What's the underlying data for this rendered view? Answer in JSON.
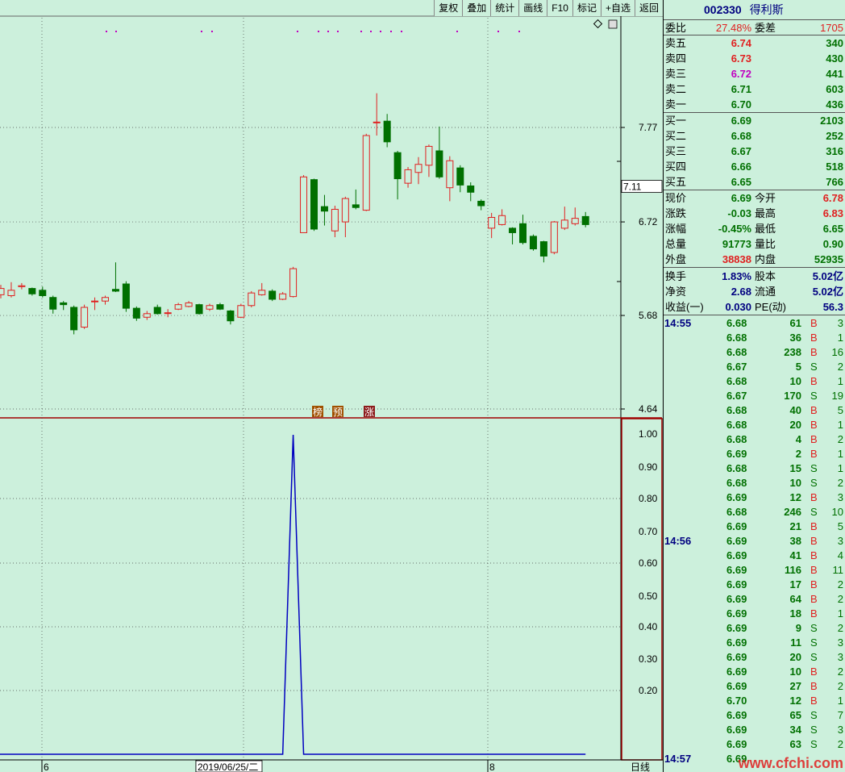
{
  "toolbar": {
    "items": [
      "复权",
      "叠加",
      "统计",
      "画线",
      "F10",
      "标记",
      "+自选",
      "返回"
    ]
  },
  "price_axis": {
    "labels": [
      "7.77",
      "7.11",
      "6.72",
      "5.68",
      "4.64"
    ]
  },
  "indicator_axis": {
    "labels": [
      "1.00",
      "0.90",
      "0.80",
      "0.70",
      "0.60",
      "0.50",
      "0.40",
      "0.30",
      "0.20"
    ]
  },
  "date_axis": {
    "labels": [
      "6",
      "2019/06/25/二",
      "8"
    ],
    "period": "日线"
  },
  "event_markers": [
    "榜",
    "预",
    "涨"
  ],
  "chart_data": [
    {
      "type": "candlestick",
      "title": "",
      "ylim": [
        4.64,
        8.2
      ],
      "current_price_tag": 7.11,
      "candles": [
        {
          "o": 5.91,
          "c": 5.98,
          "h": 6.02,
          "l": 5.87
        },
        {
          "o": 5.9,
          "c": 5.96,
          "h": 6.05,
          "l": 5.88
        },
        {
          "o": 6.0,
          "c": 6.01,
          "h": 6.04,
          "l": 5.97
        },
        {
          "o": 5.98,
          "c": 5.92,
          "h": 5.99,
          "l": 5.9
        },
        {
          "o": 5.96,
          "c": 5.9,
          "h": 6.0,
          "l": 5.88
        },
        {
          "o": 5.88,
          "c": 5.75,
          "h": 5.9,
          "l": 5.7
        },
        {
          "o": 5.82,
          "c": 5.8,
          "h": 5.84,
          "l": 5.74
        },
        {
          "o": 5.77,
          "c": 5.52,
          "h": 5.79,
          "l": 5.47
        },
        {
          "o": 5.55,
          "c": 5.77,
          "h": 5.8,
          "l": 5.53
        },
        {
          "o": 5.84,
          "c": 5.84,
          "h": 5.88,
          "l": 5.74
        },
        {
          "o": 5.84,
          "c": 5.88,
          "h": 5.9,
          "l": 5.8
        },
        {
          "o": 5.97,
          "c": 5.95,
          "h": 6.27,
          "l": 5.94
        },
        {
          "o": 6.03,
          "c": 5.76,
          "h": 6.06,
          "l": 5.72
        },
        {
          "o": 5.76,
          "c": 5.65,
          "h": 5.78,
          "l": 5.62
        },
        {
          "o": 5.66,
          "c": 5.7,
          "h": 5.73,
          "l": 5.63
        },
        {
          "o": 5.77,
          "c": 5.7,
          "h": 5.8,
          "l": 5.69
        },
        {
          "o": 5.71,
          "c": 5.71,
          "h": 5.75,
          "l": 5.66
        },
        {
          "o": 5.75,
          "c": 5.8,
          "h": 5.82,
          "l": 5.74
        },
        {
          "o": 5.78,
          "c": 5.82,
          "h": 5.84,
          "l": 5.77
        },
        {
          "o": 5.8,
          "c": 5.7,
          "h": 5.81,
          "l": 5.69
        },
        {
          "o": 5.75,
          "c": 5.79,
          "h": 5.81,
          "l": 5.73
        },
        {
          "o": 5.8,
          "c": 5.75,
          "h": 5.82,
          "l": 5.74
        },
        {
          "o": 5.73,
          "c": 5.62,
          "h": 5.74,
          "l": 5.58
        },
        {
          "o": 5.66,
          "c": 5.79,
          "h": 5.81,
          "l": 5.65
        },
        {
          "o": 5.79,
          "c": 5.93,
          "h": 5.95,
          "l": 5.77
        },
        {
          "o": 5.91,
          "c": 5.96,
          "h": 6.04,
          "l": 5.9
        },
        {
          "o": 5.95,
          "c": 5.86,
          "h": 5.97,
          "l": 5.84
        },
        {
          "o": 5.86,
          "c": 5.92,
          "h": 5.94,
          "l": 5.85
        },
        {
          "o": 5.89,
          "c": 6.2,
          "h": 6.22,
          "l": 5.88
        },
        {
          "o": 6.6,
          "c": 7.22,
          "h": 7.24,
          "l": 6.6
        },
        {
          "o": 7.19,
          "c": 6.64,
          "h": 7.2,
          "l": 6.62
        },
        {
          "o": 6.89,
          "c": 6.84,
          "h": 7.02,
          "l": 6.68
        },
        {
          "o": 6.62,
          "c": 6.86,
          "h": 6.9,
          "l": 6.55
        },
        {
          "o": 6.72,
          "c": 6.98,
          "h": 7.0,
          "l": 6.55
        },
        {
          "o": 6.91,
          "c": 6.88,
          "h": 7.08,
          "l": 6.86
        },
        {
          "o": 6.85,
          "c": 7.68,
          "h": 7.7,
          "l": 6.84
        },
        {
          "o": 7.83,
          "c": 7.83,
          "h": 8.15,
          "l": 7.68
        },
        {
          "o": 7.84,
          "c": 7.61,
          "h": 7.92,
          "l": 7.55
        },
        {
          "o": 7.49,
          "c": 7.2,
          "h": 7.51,
          "l": 6.97
        },
        {
          "o": 7.15,
          "c": 7.3,
          "h": 7.33,
          "l": 7.1
        },
        {
          "o": 7.27,
          "c": 7.36,
          "h": 7.44,
          "l": 7.14
        },
        {
          "o": 7.35,
          "c": 7.56,
          "h": 7.58,
          "l": 7.22
        },
        {
          "o": 7.51,
          "c": 7.22,
          "h": 7.78,
          "l": 7.2
        },
        {
          "o": 7.1,
          "c": 7.4,
          "h": 7.45,
          "l": 6.95
        },
        {
          "o": 7.32,
          "c": 7.13,
          "h": 7.35,
          "l": 7.05
        },
        {
          "o": 7.12,
          "c": 7.05,
          "h": 7.16,
          "l": 6.95
        },
        {
          "o": 6.95,
          "c": 6.9,
          "h": 6.97,
          "l": 6.85
        },
        {
          "o": 6.65,
          "c": 6.77,
          "h": 6.82,
          "l": 6.54
        },
        {
          "o": 6.69,
          "c": 6.79,
          "h": 6.86,
          "l": 6.68
        },
        {
          "o": 6.65,
          "c": 6.6,
          "h": 6.66,
          "l": 6.47
        },
        {
          "o": 6.7,
          "c": 6.49,
          "h": 6.8,
          "l": 6.47
        },
        {
          "o": 6.56,
          "c": 6.42,
          "h": 6.58,
          "l": 6.4
        },
        {
          "o": 6.5,
          "c": 6.34,
          "h": 6.51,
          "l": 6.27
        },
        {
          "o": 6.38,
          "c": 6.72,
          "h": 6.73,
          "l": 6.36
        },
        {
          "o": 6.65,
          "c": 6.74,
          "h": 6.89,
          "l": 6.63
        },
        {
          "o": 6.7,
          "c": 6.76,
          "h": 6.88,
          "l": 6.68
        },
        {
          "o": 6.78,
          "c": 6.69,
          "h": 6.83,
          "l": 6.66
        }
      ]
    },
    {
      "type": "line",
      "title": "",
      "ylim": [
        0,
        1.05
      ],
      "values": [
        0,
        0,
        0,
        0,
        0,
        0,
        0,
        0,
        0,
        0,
        0,
        0,
        0,
        0,
        0,
        0,
        0,
        0,
        0,
        0,
        0,
        0,
        0,
        0,
        0,
        0,
        0,
        0,
        1,
        0,
        0,
        0,
        0,
        0,
        0,
        0,
        0,
        0,
        0,
        0,
        0,
        0,
        0,
        0,
        0,
        0,
        0,
        0,
        0,
        0,
        0,
        0,
        0,
        0,
        0,
        0,
        0
      ]
    }
  ],
  "stock": {
    "code": "002330",
    "name": "得利斯"
  },
  "ratio": {
    "weibi_label": "委比",
    "weibi": "27.48%",
    "weicha_label": "委差",
    "weicha": "1705"
  },
  "asks": [
    {
      "label": "卖五",
      "price": "6.74",
      "vol": "340",
      "cls": "red"
    },
    {
      "label": "卖四",
      "price": "6.73",
      "vol": "430",
      "cls": "red"
    },
    {
      "label": "卖三",
      "price": "6.72",
      "vol": "441",
      "cls": "mag"
    },
    {
      "label": "卖二",
      "price": "6.71",
      "vol": "603",
      "cls": "green"
    },
    {
      "label": "卖一",
      "price": "6.70",
      "vol": "436",
      "cls": "green"
    }
  ],
  "bids": [
    {
      "label": "买一",
      "price": "6.69",
      "vol": "2103",
      "cls": "green"
    },
    {
      "label": "买二",
      "price": "6.68",
      "vol": "252",
      "cls": "green"
    },
    {
      "label": "买三",
      "price": "6.67",
      "vol": "316",
      "cls": "green"
    },
    {
      "label": "买四",
      "price": "6.66",
      "vol": "518",
      "cls": "green"
    },
    {
      "label": "买五",
      "price": "6.65",
      "vol": "766",
      "cls": "green"
    }
  ],
  "quote": [
    {
      "l1": "现价",
      "v1": "6.69",
      "c1": "green",
      "l2": "今开",
      "v2": "6.78",
      "c2": "red"
    },
    {
      "l1": "涨跌",
      "v1": "-0.03",
      "c1": "green",
      "l2": "最高",
      "v2": "6.83",
      "c2": "red"
    },
    {
      "l1": "涨幅",
      "v1": "-0.45%",
      "c1": "green",
      "l2": "最低",
      "v2": "6.65",
      "c2": "green"
    },
    {
      "l1": "总量",
      "v1": "91773",
      "c1": "green",
      "l2": "量比",
      "v2": "0.90",
      "c2": "green"
    },
    {
      "l1": "外盘",
      "v1": "38838",
      "c1": "red",
      "l2": "内盘",
      "v2": "52935",
      "c2": "green"
    }
  ],
  "fundamentals": [
    {
      "l1": "换手",
      "v1": "1.83%",
      "l2": "股本",
      "v2": "5.02亿"
    },
    {
      "l1": "净资",
      "v1": "2.68",
      "l2": "流通",
      "v2": "5.02亿"
    },
    {
      "l1": "收益(一)",
      "v1": "0.030",
      "l2": "PE(动)",
      "v2": "56.3"
    }
  ],
  "ticks": [
    {
      "time": "14:55",
      "price": "6.68",
      "vol": "61",
      "side": "B",
      "n": "3"
    },
    {
      "time": "",
      "price": "6.68",
      "vol": "36",
      "side": "B",
      "n": "1"
    },
    {
      "time": "",
      "price": "6.68",
      "vol": "238",
      "side": "B",
      "n": "16"
    },
    {
      "time": "",
      "price": "6.67",
      "vol": "5",
      "side": "S",
      "n": "2"
    },
    {
      "time": "",
      "price": "6.68",
      "vol": "10",
      "side": "B",
      "n": "1"
    },
    {
      "time": "",
      "price": "6.67",
      "vol": "170",
      "side": "S",
      "n": "19"
    },
    {
      "time": "",
      "price": "6.68",
      "vol": "40",
      "side": "B",
      "n": "5"
    },
    {
      "time": "",
      "price": "6.68",
      "vol": "20",
      "side": "B",
      "n": "1"
    },
    {
      "time": "",
      "price": "6.68",
      "vol": "4",
      "side": "B",
      "n": "2"
    },
    {
      "time": "",
      "price": "6.69",
      "vol": "2",
      "side": "B",
      "n": "1"
    },
    {
      "time": "",
      "price": "6.68",
      "vol": "15",
      "side": "S",
      "n": "1"
    },
    {
      "time": "",
      "price": "6.68",
      "vol": "10",
      "side": "S",
      "n": "2"
    },
    {
      "time": "",
      "price": "6.69",
      "vol": "12",
      "side": "B",
      "n": "3"
    },
    {
      "time": "",
      "price": "6.68",
      "vol": "246",
      "side": "S",
      "n": "10"
    },
    {
      "time": "",
      "price": "6.69",
      "vol": "21",
      "side": "B",
      "n": "5"
    },
    {
      "time": "14:56",
      "price": "6.69",
      "vol": "38",
      "side": "B",
      "n": "3"
    },
    {
      "time": "",
      "price": "6.69",
      "vol": "41",
      "side": "B",
      "n": "4"
    },
    {
      "time": "",
      "price": "6.69",
      "vol": "116",
      "side": "B",
      "n": "11"
    },
    {
      "time": "",
      "price": "6.69",
      "vol": "17",
      "side": "B",
      "n": "2"
    },
    {
      "time": "",
      "price": "6.69",
      "vol": "64",
      "side": "B",
      "n": "2"
    },
    {
      "time": "",
      "price": "6.69",
      "vol": "18",
      "side": "B",
      "n": "1"
    },
    {
      "time": "",
      "price": "6.69",
      "vol": "9",
      "side": "S",
      "n": "2"
    },
    {
      "time": "",
      "price": "6.69",
      "vol": "11",
      "side": "S",
      "n": "3"
    },
    {
      "time": "",
      "price": "6.69",
      "vol": "20",
      "side": "S",
      "n": "3"
    },
    {
      "time": "",
      "price": "6.69",
      "vol": "10",
      "side": "B",
      "n": "2"
    },
    {
      "time": "",
      "price": "6.69",
      "vol": "27",
      "side": "B",
      "n": "2"
    },
    {
      "time": "",
      "price": "6.70",
      "vol": "12",
      "side": "B",
      "n": "1"
    },
    {
      "time": "",
      "price": "6.69",
      "vol": "65",
      "side": "S",
      "n": "7"
    },
    {
      "time": "",
      "price": "6.69",
      "vol": "34",
      "side": "S",
      "n": "3"
    },
    {
      "time": "",
      "price": "6.69",
      "vol": "63",
      "side": "S",
      "n": "2"
    },
    {
      "time": "14:57",
      "price": "6.69",
      "vol": "",
      "side": "",
      "n": ""
    }
  ],
  "watermark": "www.cfchi.com",
  "colors": {
    "bg": "#ccf0dc",
    "up": "#e02020",
    "down": "#007000",
    "line": "#0000c0",
    "frame": "#a00000"
  }
}
